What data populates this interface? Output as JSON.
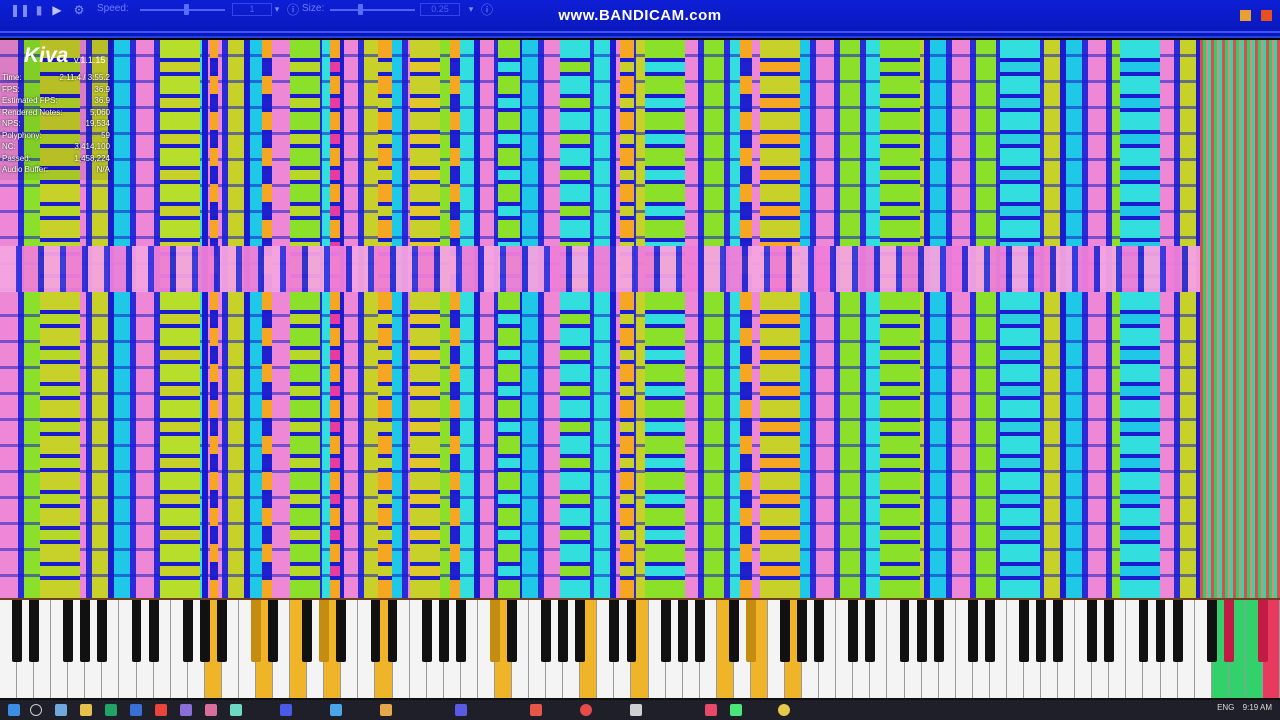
{
  "toolbar": {
    "pause_icon": "pause-icon",
    "play_icon": "play-icon",
    "settings_icon": "gear-icon",
    "speed_label": "Speed:",
    "speed_value": "1",
    "speed_level": 0.55,
    "size_label": "Size:",
    "size_value": "0.25",
    "size_level": 0.35
  },
  "watermark": "www.BANDICAM.com",
  "stats": {
    "title": "Kiva",
    "version": "v.1.1.15",
    "rows": [
      {
        "label": "Time:",
        "value": "2:11.4 / 3:55.2"
      },
      {
        "label": "FPS:",
        "value": "36.9"
      },
      {
        "label": "Estimated FPS:",
        "value": "36.9"
      },
      {
        "label": "Rendered Notes:",
        "value": "5,060"
      },
      {
        "label": "NPS:",
        "value": "19,534"
      },
      {
        "label": "Polyphony:",
        "value": "59"
      },
      {
        "label": "NC:",
        "value": "3,414,100"
      },
      {
        "label": "Passed:",
        "value": "1,458,224"
      },
      {
        "label": "Audio Buffer:",
        "value": "N/A"
      }
    ]
  },
  "colors": {
    "toolbar": "#0d1fd6",
    "note_pink": "#ee88d6",
    "note_green": "#8be02a",
    "note_cyan": "#33dede",
    "note_yellow": "#c8d02a",
    "key_highlight": "#f0b429"
  },
  "taskbar": {
    "icons": [
      "windows-icon",
      "search-icon",
      "task-view-icon",
      "file-explorer-icon",
      "excel-icon",
      "edge-icon",
      "chrome-icon"
    ],
    "language": "ENG",
    "clock": "9:19 AM"
  }
}
